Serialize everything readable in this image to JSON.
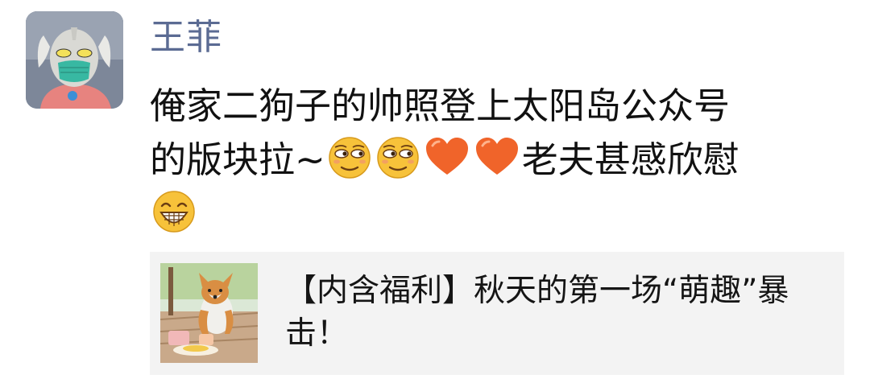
{
  "post": {
    "author_name": "王菲",
    "avatar_icon": "ultraman-masked-avatar",
    "text_line1": "俺家二狗子的帅照登上太阳岛公众号",
    "text_line2_prefix": "的版块拉~",
    "text_line2_suffix": "老夫甚感欣慰",
    "emojis": [
      "smirk-emoji",
      "smirk-emoji",
      "orange-heart-emoji",
      "orange-heart-emoji",
      "grin-emoji"
    ]
  },
  "shared_article": {
    "title": "【内含福利】秋天的第一场“萌趣”暴击！",
    "thumbnail_icon": "corgi-photo-thumbnail"
  },
  "colors": {
    "name": "#5b6b93",
    "text": "#111111",
    "card_bg": "#f3f3f3",
    "heart": "#f0642a"
  }
}
